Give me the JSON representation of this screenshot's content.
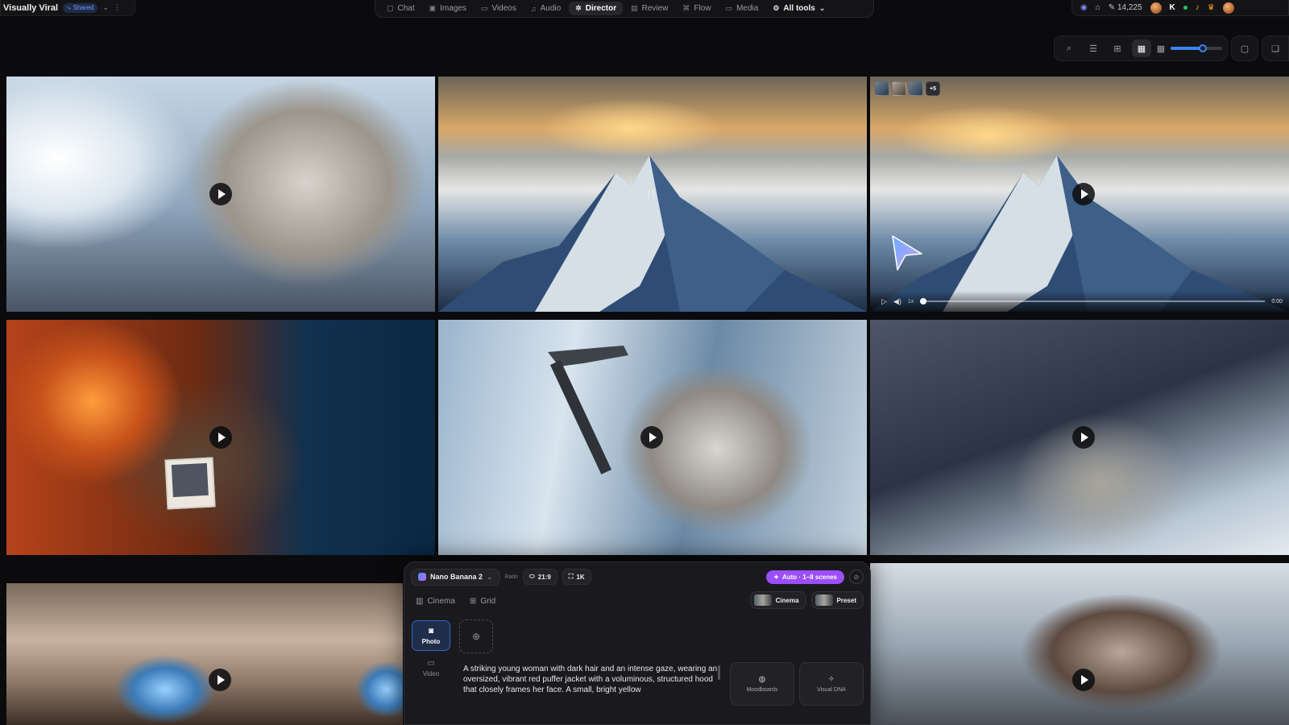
{
  "app": {
    "title": "Visually Viral",
    "shared_label": "Shared"
  },
  "nav": {
    "items": [
      {
        "label": "Chat",
        "icon": "chat-icon",
        "glyph": "▢",
        "active": false
      },
      {
        "label": "Images",
        "icon": "image-icon",
        "glyph": "▣",
        "active": false
      },
      {
        "label": "Videos",
        "icon": "video-icon",
        "glyph": "▭",
        "active": false
      },
      {
        "label": "Audio",
        "icon": "music-icon",
        "glyph": "♫",
        "active": false
      },
      {
        "label": "Director",
        "icon": "director-icon",
        "glyph": "✲",
        "active": true
      },
      {
        "label": "Review",
        "icon": "review-icon",
        "glyph": "▤",
        "active": false
      },
      {
        "label": "Flow",
        "icon": "flow-icon",
        "glyph": "⌘",
        "active": false
      },
      {
        "label": "Media",
        "icon": "folder-icon",
        "glyph": "▭",
        "active": false
      }
    ],
    "all_tools_label": "All tools"
  },
  "header_right": {
    "credits": "14,225",
    "avatar_initial": "K"
  },
  "view_toolbar": {
    "zoom_fraction": 0.62,
    "active_view": "grid-large"
  },
  "tiles": [
    {
      "name": "hooded-man-snow"
    },
    {
      "name": "mountain-peak-sunrise"
    },
    {
      "name": "mountain-peak-playing"
    },
    {
      "name": "man-in-orange-tent"
    },
    {
      "name": "man-with-ice-axe"
    },
    {
      "name": "man-looking-up-storm"
    },
    {
      "name": "frozen-eyes-closeup"
    },
    {
      "name": "man-shouting-snow"
    }
  ],
  "player": {
    "thumbs_more": "+5",
    "speed": "1x",
    "time": "0:00"
  },
  "composer": {
    "model": "Nano Banana 2",
    "ratio_label": "Ratio",
    "ratio": "21:9",
    "resolution": "1K",
    "auto_label": "Auto · 1–8 scenes",
    "mode_tabs": [
      "Cinema",
      "Grid"
    ],
    "style_cinema": "Cinema",
    "style_preset": "Preset",
    "photo_label": "Photo",
    "video_label": "Video",
    "prompt": "A striking young woman with dark hair and an intense gaze, wearing an oversized, vibrant red puffer jacket with a voluminous, structured hood that closely frames her face. A small, bright yellow",
    "moodboards_label": "Moodboards",
    "visual_dna_label": "Visual DNA"
  },
  "colors": {
    "accent_blue": "#3b82f6",
    "auto_purple": "#9b4dff",
    "background": "#0b0b0d"
  }
}
